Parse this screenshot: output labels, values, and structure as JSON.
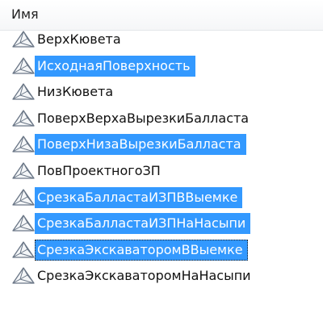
{
  "header": {
    "label": "Имя"
  },
  "colors": {
    "selection": "#3399ff",
    "selection_text": "#ffffff"
  },
  "items": [
    {
      "label": "ВерхКювета",
      "selected": false,
      "focused": false,
      "icon": "surface-icon"
    },
    {
      "label": "ИсходнаяПоверхность",
      "selected": true,
      "focused": false,
      "icon": "surface-icon"
    },
    {
      "label": "НизКювета",
      "selected": false,
      "focused": false,
      "icon": "surface-icon"
    },
    {
      "label": "ПоверхВерхаВырезкиБалласта",
      "selected": false,
      "focused": false,
      "icon": "surface-icon"
    },
    {
      "label": "ПоверхНизаВырезкиБалласта",
      "selected": true,
      "focused": false,
      "icon": "surface-icon"
    },
    {
      "label": "ПовПроектногоЗП",
      "selected": false,
      "focused": false,
      "icon": "surface-icon"
    },
    {
      "label": "СрезкаБалластаИЗПВВыемке",
      "selected": true,
      "focused": false,
      "icon": "surface-icon"
    },
    {
      "label": "СрезкаБалластаИЗПНаНасыпи",
      "selected": true,
      "focused": false,
      "icon": "surface-icon"
    },
    {
      "label": "СрезкаЭкскаваторомВВыемке",
      "selected": true,
      "focused": true,
      "icon": "surface-icon"
    },
    {
      "label": "СрезкаЭкскаваторомНаНасыпи",
      "selected": false,
      "focused": false,
      "icon": "surface-icon"
    }
  ]
}
